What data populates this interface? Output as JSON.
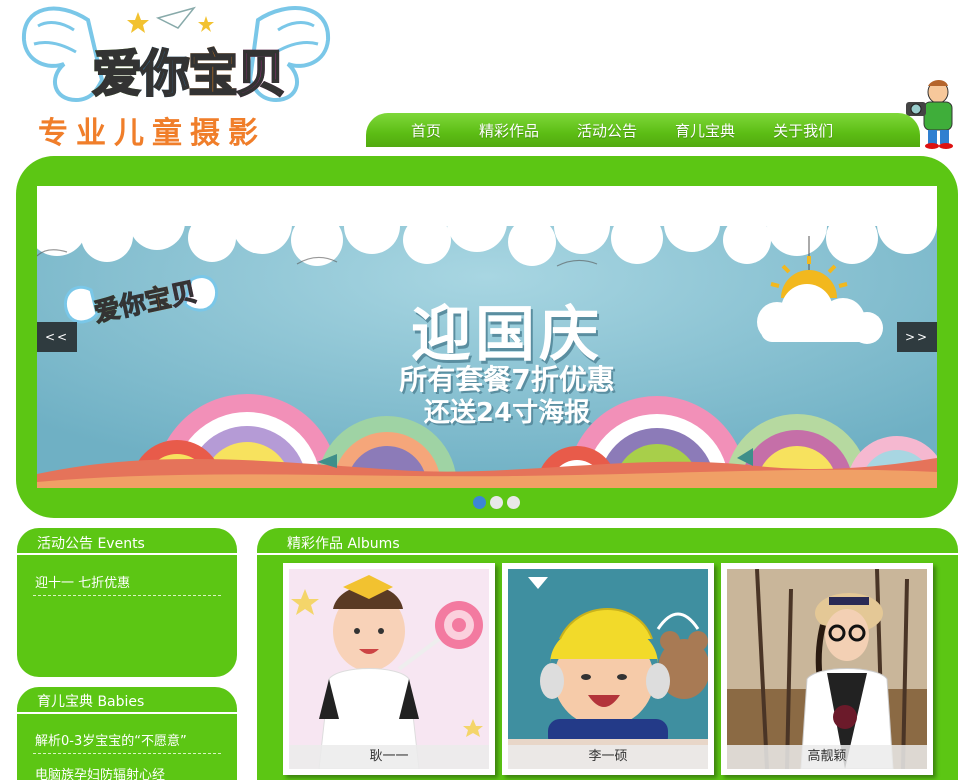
{
  "header": {
    "logo_text": "爱你宝贝",
    "logo_slogan": "专业儿童摄影",
    "nav": [
      {
        "label": "首页"
      },
      {
        "label": "精彩作品"
      },
      {
        "label": "活动公告"
      },
      {
        "label": "育儿宝典"
      },
      {
        "label": "关于我们"
      }
    ]
  },
  "banner": {
    "logo_text": "爱你宝贝",
    "title": "迎国庆",
    "line1": "所有套餐7折优惠",
    "line2": "还送24寸海报",
    "prev_label": "<<",
    "next_label": ">>",
    "slide_count": 3,
    "active_slide": 1
  },
  "events": {
    "title": "活动公告 Events",
    "items": [
      {
        "label": "迎十一  七折优惠"
      }
    ]
  },
  "babies": {
    "title": "育儿宝典 Babies",
    "items": [
      {
        "label": "解析0-3岁宝宝的“不愿意”"
      },
      {
        "label": "电脑族孕妇防辐射心经"
      }
    ]
  },
  "albums": {
    "title": "精彩作品 Albums",
    "cards": [
      {
        "caption": "耿一一"
      },
      {
        "caption": "李一硕"
      },
      {
        "caption": "高靓颖"
      }
    ]
  },
  "colors": {
    "brand_green": "#5cc614",
    "nav_green": "#5cbd14",
    "banner_sky": "#87bfd0",
    "slider_button": "#2f3b3f",
    "active_dot": "#3c86d6"
  }
}
